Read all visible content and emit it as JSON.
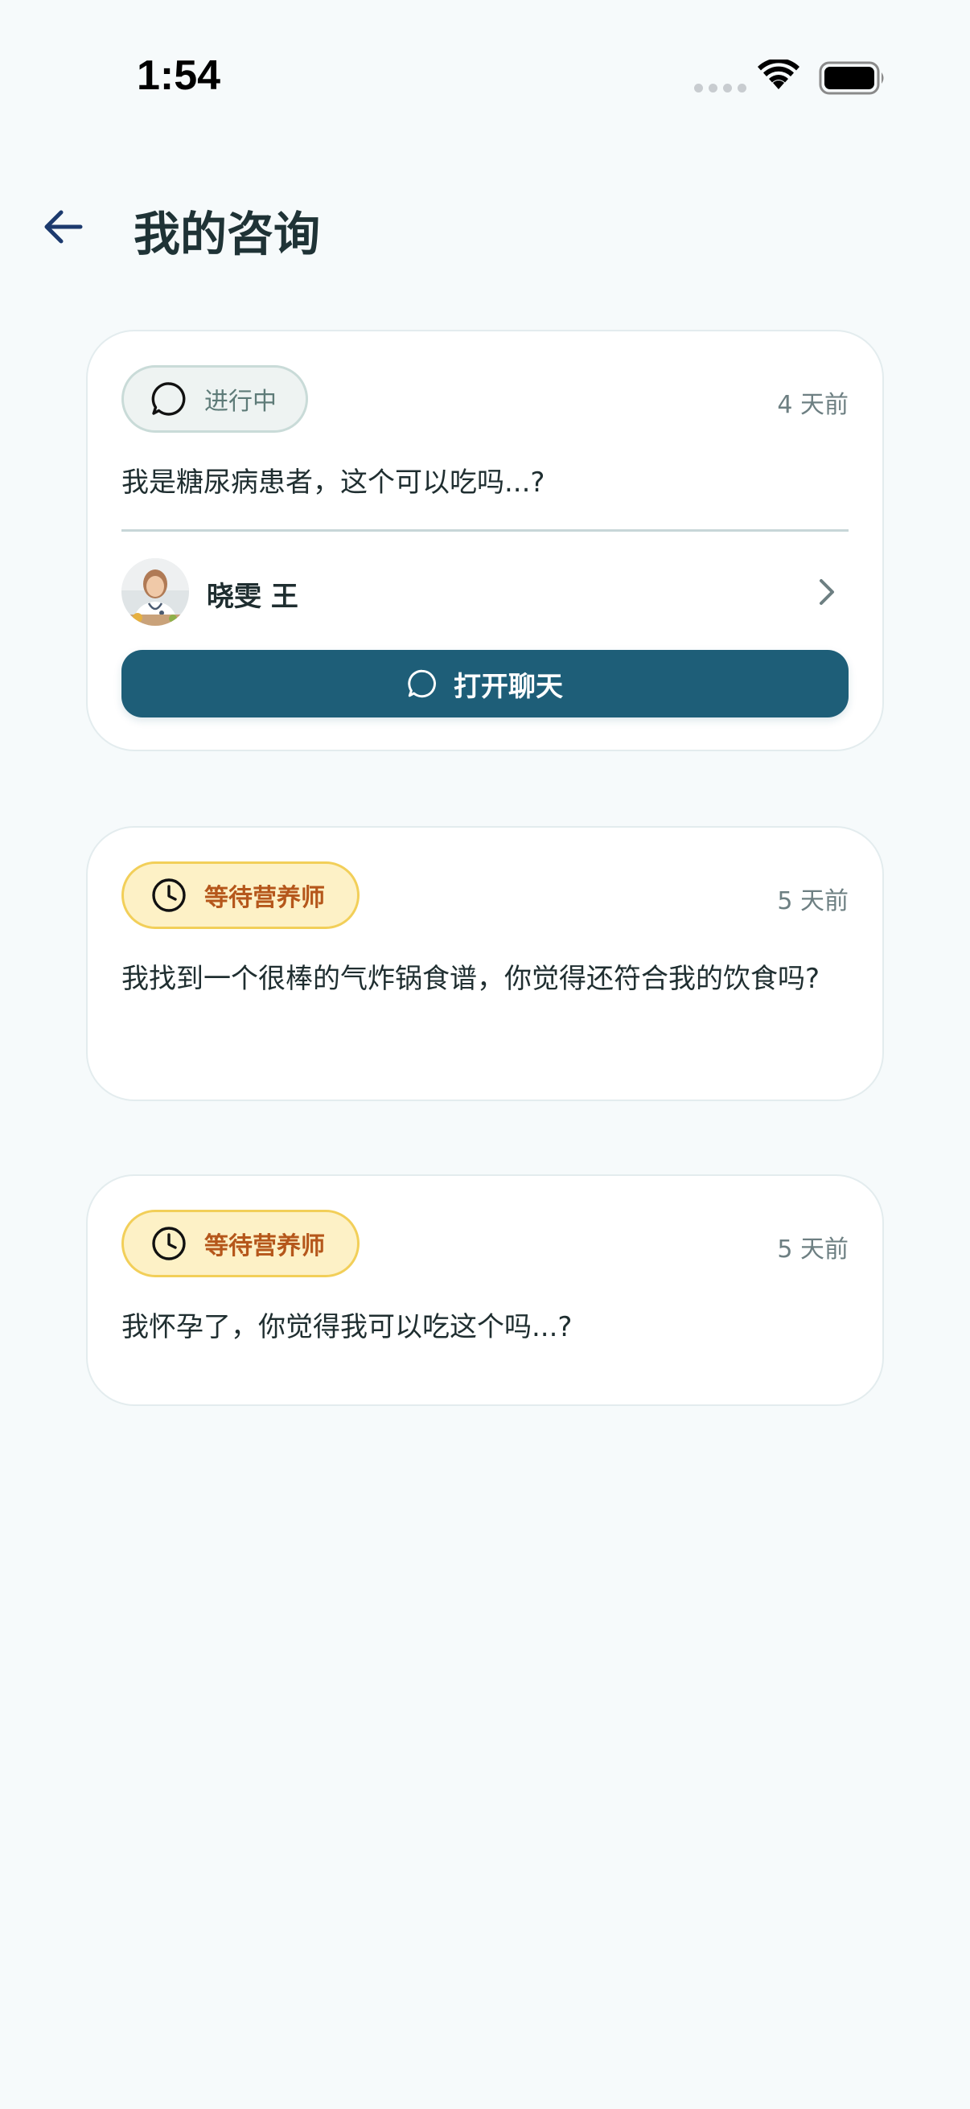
{
  "status_bar": {
    "time": "1:54",
    "icons": [
      "cellular-dots-icon",
      "wifi-icon",
      "battery-icon"
    ]
  },
  "header": {
    "back_icon": "arrow-left-icon",
    "title": "我的咨询"
  },
  "consultations": [
    {
      "status": "进行中",
      "status_icon": "chat-bubble-icon",
      "time_ago": "4 天前",
      "question": "我是糖尿病患者，这个可以吃吗...?",
      "nutritionist_name": "晓雯 王",
      "button_label": "打开聊天",
      "button_icon": "chat-bubble-icon"
    },
    {
      "status": "等待营养师",
      "status_icon": "clock-icon",
      "time_ago": "5 天前",
      "question": "我找到一个很棒的气炸锅食谱，你觉得还符合我的饮食吗?"
    },
    {
      "status": "等待营养师",
      "status_icon": "clock-icon",
      "time_ago": "5 天前",
      "question": "我怀孕了，你觉得我可以吃这个吗...?"
    }
  ],
  "colors": {
    "background": "#f6fafb",
    "card": "#ffffff",
    "primary_button": "#1e5e78",
    "progress_badge_bg": "#eef3f2",
    "waiting_badge_bg": "#fdf1c6",
    "waiting_badge_text": "#b5571b",
    "back_arrow": "#1c3a6e"
  }
}
